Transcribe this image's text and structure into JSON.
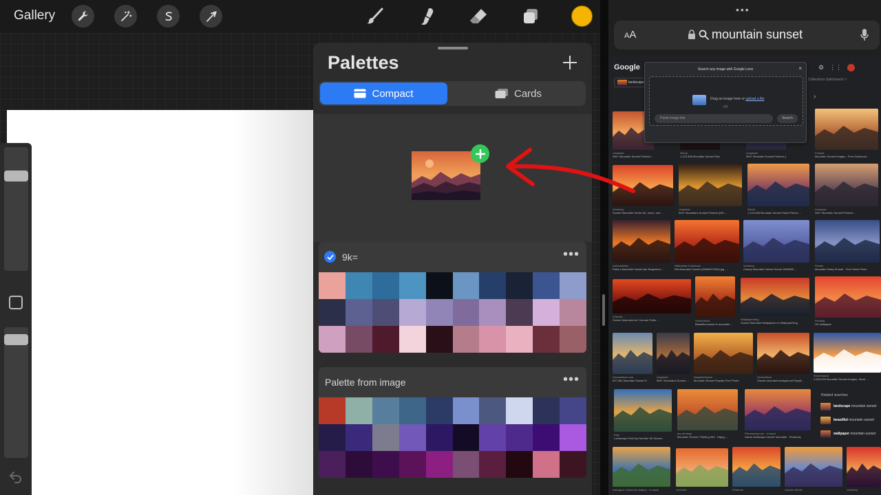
{
  "procreate": {
    "gallery_label": "Gallery",
    "tools_left": [
      "wrench-icon",
      "magic-wand-icon",
      "selection-s-icon",
      "transform-arrow-icon"
    ],
    "tools_right": [
      "brush-icon",
      "smudge-icon",
      "eraser-icon",
      "layers-icon"
    ],
    "current_color": "#f5b400",
    "palettes": {
      "title": "Palettes",
      "add_icon": "plus-icon",
      "tabs": [
        {
          "label": "Compact",
          "icon": "compact-card-icon",
          "selected": true
        },
        {
          "label": "Cards",
          "icon": "cards-stack-icon",
          "selected": false
        }
      ],
      "palette_list": [
        {
          "name": "9k=",
          "default": true,
          "more": "•••",
          "swatches": [
            "#e9a39c",
            "#3f86b3",
            "#2e6c9b",
            "#4e94c2",
            "#0c1119",
            "#6b96c4",
            "#253e6a",
            "#1a2236",
            "#3c5591",
            "#8d9ccb",
            "#2c2f4a",
            "#5d6191",
            "#4d4d76",
            "#b6a9d4",
            "#9185b8",
            "#7f6b9c",
            "#a98fbe",
            "#4c3a52",
            "#d5b0da",
            "#b8879e",
            "#cfa0bf",
            "#764b63",
            "#4e1a2c",
            "#f3d4dd",
            "#2a0f18",
            "#b57d8c",
            "#d893a8",
            "#eab2c1",
            "#6b2f3b",
            "#9a6067"
          ]
        },
        {
          "name": "Palette from image",
          "default": false,
          "more": "•••",
          "swatches": [
            "#b73927",
            "#8fb0a7",
            "#587e9d",
            "#3d6689",
            "#2c3a66",
            "#7a90cc",
            "#4d5881",
            "#cfd7ef",
            "#2c3259",
            "#45458a",
            "#251c4a",
            "#3b2a7c",
            "#7c7c8e",
            "#7258b8",
            "#2d1864",
            "#140c26",
            "#6241a8",
            "#4f2a8d",
            "#3d0d73",
            "#a95ae0",
            "#4a1f5c",
            "#2e0c3a",
            "#3e0e4c",
            "#5c1259",
            "#8d1f82",
            "#7b4e74",
            "#5a1f3e",
            "#230811",
            "#d07089",
            "#3d1422"
          ]
        }
      ]
    }
  },
  "browser": {
    "more_dots": "•••",
    "text_size_label_small": "A",
    "text_size_label_big": "A",
    "query": "mountain sunset",
    "google_logo": "Google",
    "chips": [
      "landscape"
    ],
    "collections_text": "Collections   SafeSearch ˅",
    "lens": {
      "title": "Search any image with Google Lens",
      "close": "×",
      "drag_text": "Drag an image here or ",
      "upload_link": "upload a file",
      "or_text": "OR",
      "paste_placeholder": "Paste image link",
      "search_button": "Search"
    },
    "results": [
      {
        "source": "Unsplash",
        "title": "30k+ Mountain Sunset Pictures ..."
      },
      {
        "source": "iStock",
        "title": "1,123,358 Mountain Sunset Stock Photos ..."
      },
      {
        "source": "Unsplash",
        "title": "500+ Mountain Sunset Pictures [HD ..."
      },
      {
        "source": "Freepik",
        "title": "Mountain Sunset Images - Free Download ..."
      },
      {
        "source": "Vecteezy",
        "title": "Sunset Mountain Vector Art, Icons, and ..."
      },
      {
        "source": "Unsplash",
        "title": "500+ Mountains Sunset Pictures [HD ..."
      },
      {
        "source": "iStock",
        "title": "1,123,358 Mountain Sunset Stock Photos ..."
      },
      {
        "source": "Unsplash",
        "title": "30k+ Mountain Sunset Pictures ..."
      },
      {
        "source": "Instructables",
        "title": "Paint a Mountain Sunset (for Beginners ..."
      },
      {
        "source": "Wikimedia Commons",
        "title": "File:Mountain Sunset (33669497845).jpg ..."
      },
      {
        "source": "Vecteezy",
        "title": "Cloudy Mountain Sunset Scene 2562968 ..."
      },
      {
        "source": "Pexels",
        "title": "Mountain Daisy Sunset · Free Stock Photo"
      },
      {
        "source": "iCanvas",
        "title": "Sunset Mountain Art: Canvas Prints ..."
      },
      {
        "source": "VectorStock",
        "title": "Beautiful sunset in mountain ..."
      },
      {
        "source": "Wallpapersdog",
        "title": "Sunset Mountain Wallpapers on WallpaperDog"
      },
      {
        "source": "Pixabay",
        "title": "HD wallpaper"
      },
      {
        "source": "Dreamstime.com",
        "title": "537,364 Mountain Sunset S..."
      },
      {
        "source": "Unsplash",
        "title": "500+ Mountains Sunset ..."
      },
      {
        "source": "NegativeSpace",
        "title": "Mountain Sunset Royalty Free Photo"
      },
      {
        "source": "VectorStock",
        "title": "Sunset mountain background Royalt..."
      },
      {
        "source": "Shutterstock",
        "title": "2,549,033 Mountain Sunset Images, Stock ..."
      },
      {
        "source": "Etsy",
        "title": "Landscape Paint by Number Kit Sunset ..."
      },
      {
        "source": "my art blog!",
        "title": "Mountain Sunset, Painting #64 · Happy ..."
      },
      {
        "source": "Picmonkey.com · In stock",
        "title": "nature landscape sunset mountain · Shamudy"
      },
      {
        "source": "Artmajeur Online Art Gallery · In stock",
        "title": ""
      },
      {
        "source": "YouTube",
        "title": ""
      },
      {
        "source": "Pinterest",
        "title": ""
      },
      {
        "source": "Golden Hill Art",
        "title": ""
      },
      {
        "source": "Vecteezy",
        "title": ""
      }
    ],
    "related": {
      "heading": "Related searches",
      "items": [
        {
          "bold": "landscape",
          "rest": " mountain sunset"
        },
        {
          "bold": "beautiful",
          "rest": " mountain sunset"
        },
        {
          "bold": "wallpaper",
          "rest": " mountain sunset"
        }
      ]
    }
  }
}
